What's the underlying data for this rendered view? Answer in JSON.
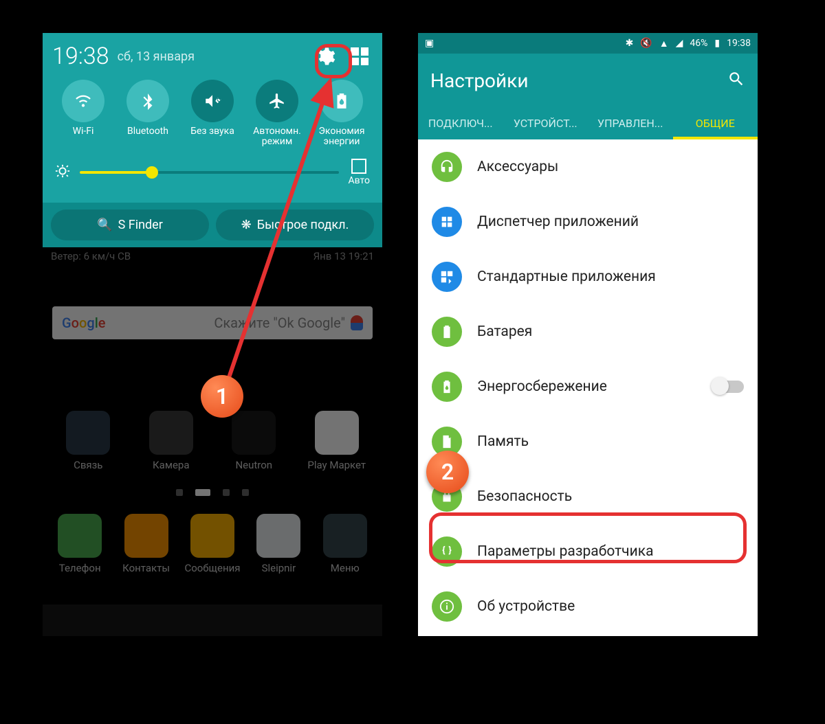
{
  "colors": {
    "teal": "#109797",
    "teal_dark": "#0a7b7b",
    "accent_yellow": "#f3e600",
    "callout": "#ff5722",
    "highlight": "#e53131",
    "icon_green": "#6fbf3f",
    "icon_blue": "#1f8ae6"
  },
  "callouts": {
    "one": "1",
    "two": "2"
  },
  "left": {
    "time": "19:38",
    "date": "сб, 13 января",
    "toggles": [
      {
        "label": "Wi-Fi",
        "state": "on",
        "icon": "wifi"
      },
      {
        "label": "Bluetooth",
        "state": "on",
        "icon": "bluetooth"
      },
      {
        "label": "Без звука",
        "state": "off",
        "icon": "mute"
      },
      {
        "label_line1": "Автономн.",
        "label_line2": "режим",
        "state": "off",
        "icon": "airplane"
      },
      {
        "label_line1": "Экономия",
        "label_line2": "энергии",
        "state": "on",
        "icon": "battery-eco"
      }
    ],
    "brightness": {
      "auto_label": "Авто",
      "percent": 28
    },
    "shortcut_buttons": {
      "sfinder": "S Finder",
      "quickconnect": "Быстрое подкл."
    },
    "weather": {
      "wind": "Ветер: 6 км/ч СВ",
      "timestamp": "Янв 13  19:21"
    },
    "search": {
      "placeholder": "Скажите \"Ok Google\""
    },
    "home_apps_row": [
      {
        "label": "Связь",
        "icon": "folder"
      },
      {
        "label": "Камера",
        "icon": "camera"
      },
      {
        "label": "Neutron",
        "icon": "play"
      },
      {
        "label": "Play Маркет",
        "icon": "playstore"
      }
    ],
    "dock": [
      {
        "label": "Телефон",
        "icon": "phone"
      },
      {
        "label": "Контакты",
        "icon": "contacts"
      },
      {
        "label": "Сообщения",
        "icon": "messages"
      },
      {
        "label": "Sleipnir",
        "icon": "sleipnir"
      },
      {
        "label": "Меню",
        "icon": "apps"
      }
    ]
  },
  "right": {
    "status_bar": {
      "battery_pct": "46%",
      "time": "19:38"
    },
    "title": "Настройки",
    "tabs": [
      {
        "label": "ПОДКЛЮЧ...",
        "active": false
      },
      {
        "label": "УСТРОЙСТ...",
        "active": false
      },
      {
        "label": "УПРАВЛЕН...",
        "active": false
      },
      {
        "label": "ОБЩИЕ",
        "active": true
      }
    ],
    "items": [
      {
        "label": "Аксессуары",
        "icon": "headset",
        "color": "green"
      },
      {
        "label": "Диспетчер приложений",
        "icon": "apps-grid",
        "color": "blue"
      },
      {
        "label": "Стандартные приложения",
        "icon": "apps-grid-alt",
        "color": "blue"
      },
      {
        "label": "Батарея",
        "icon": "battery",
        "color": "green"
      },
      {
        "label": "Энергосбережение",
        "icon": "battery-eco",
        "color": "green",
        "has_toggle": true,
        "toggle_on": false
      },
      {
        "label": "Память",
        "icon": "storage",
        "color": "green"
      },
      {
        "label": "Безопасность",
        "icon": "lock",
        "color": "green",
        "highlighted": true
      },
      {
        "label": "Параметры разработчика",
        "icon": "braces",
        "color": "green"
      },
      {
        "label": "Об устройстве",
        "icon": "info",
        "color": "green"
      }
    ]
  }
}
